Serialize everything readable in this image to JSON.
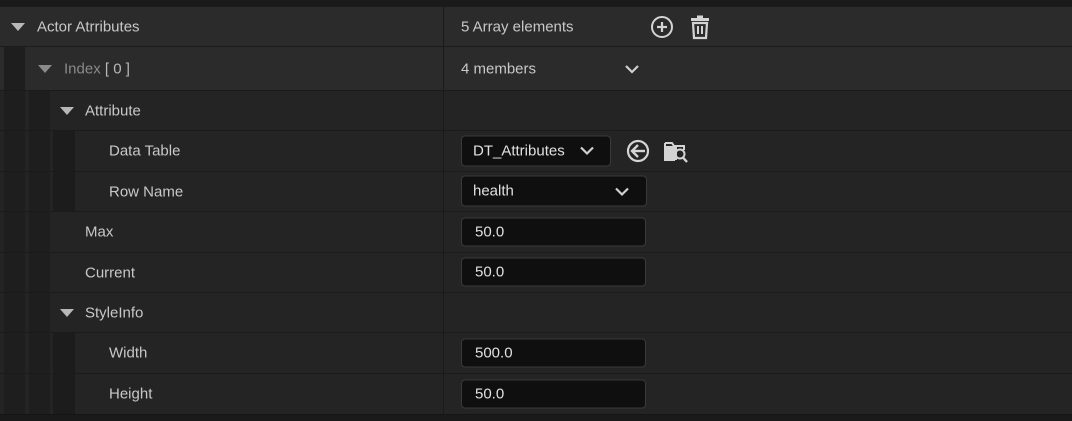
{
  "rows": {
    "actor_attributes": {
      "label": "Actor Atrributes",
      "value": "5 Array elements"
    },
    "index": {
      "label_prefix": "Index",
      "label_index": "[ 0 ]",
      "value": "4 members"
    },
    "attribute": {
      "label": "Attribute"
    },
    "data_table": {
      "label": "Data Table",
      "value": "DT_Attributes"
    },
    "row_name": {
      "label": "Row Name",
      "value": "health"
    },
    "max": {
      "label": "Max",
      "value": "50.0"
    },
    "current": {
      "label": "Current",
      "value": "50.0"
    },
    "style_info": {
      "label": "StyleInfo"
    },
    "width": {
      "label": "Width",
      "value": "500.0"
    },
    "height": {
      "label": "Height",
      "value": "50.0"
    }
  },
  "icons": {
    "add": "add-element-icon",
    "delete": "trash-icon",
    "use_selected": "use-selected-asset-icon",
    "browse": "browse-to-asset-icon",
    "expand": "expand-triangle-icon",
    "chevron": "chevron-down-icon"
  },
  "colors": {
    "background": "#151515",
    "row": "#242424",
    "header_row": "#2b2b2b",
    "input": "#0f0f0f",
    "text": "#c8c8c8"
  }
}
